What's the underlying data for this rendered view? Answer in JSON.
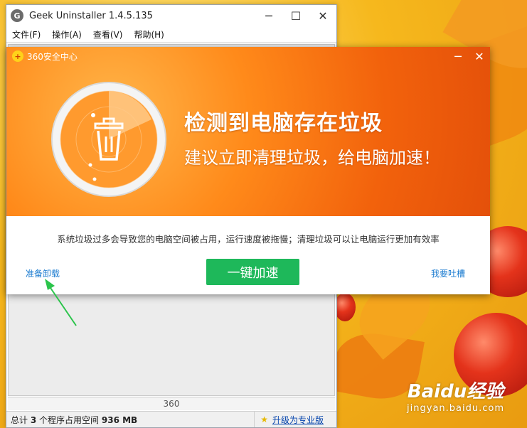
{
  "geek": {
    "title": "Geek Uninstaller 1.4.5.135",
    "menu": [
      "文件(F)",
      "操作(A)",
      "查看(V)",
      "帮助(H)"
    ],
    "list_count": "360",
    "status_prefix": "总计",
    "status_count": "3",
    "status_mid": "个程序占用空间",
    "status_size": "936 MB",
    "upgrade_label": "升级为专业版"
  },
  "popup": {
    "title": "360安全中心",
    "headline": "检测到电脑存在垃圾",
    "subline": "建议立即清理垃圾，给电脑加速！",
    "description": "系统垃圾过多会导致您的电脑空间被占用，运行速度被拖慢；清理垃圾可以让电脑运行更加有效率",
    "left_link": "准备卸载",
    "action_button": "一键加速",
    "right_link": "我要吐槽"
  },
  "watermark": {
    "main": "Baidu经验",
    "sub": "jingyan.baidu.com"
  },
  "colors": {
    "accent_orange": "#f2620c",
    "button_green": "#1eb85a",
    "link_blue": "#1a7bd0",
    "arrow_green": "#2bc44b"
  }
}
